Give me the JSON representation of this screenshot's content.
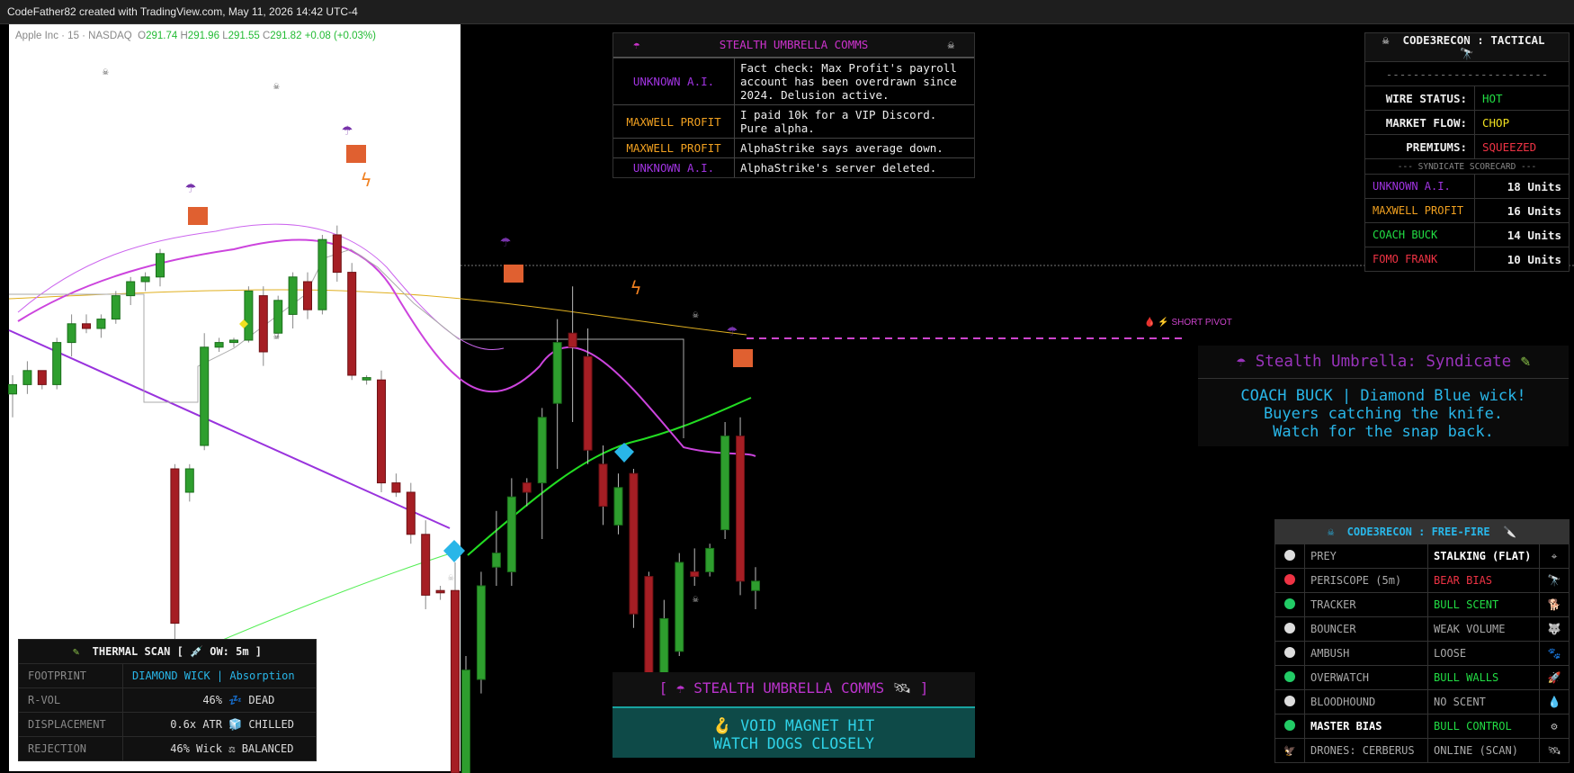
{
  "topbar": "CodeFather82 created with TradingView.com, May 11, 2026 14:42 UTC-4",
  "ohlc": {
    "symbol": "Apple Inc · 15 · NASDAQ",
    "o_label": "O",
    "o": "291.74",
    "h_label": "H",
    "h": "291.96",
    "l_label": "L",
    "l": "291.55",
    "c_label": "C",
    "c": "291.82",
    "change": "+0.08 (+0.03%)"
  },
  "pivot_label": "SHORT PIVOT",
  "comms": {
    "title": "STEALTH UMBRELLA COMMS",
    "rows": [
      {
        "who": "UNKNOWN A.I.",
        "color": "#a033e0",
        "msg": "Fact check: Max Profit's payroll account has been overdrawn since 2024. Delusion active."
      },
      {
        "who": "MAXWELL PROFIT",
        "color": "#f0a020",
        "msg": "I paid 10k for a VIP Discord. Pure alpha."
      },
      {
        "who": "MAXWELL PROFIT",
        "color": "#f0a020",
        "msg": "AlphaStrike says average down."
      },
      {
        "who": "UNKNOWN A.I.",
        "color": "#a033e0",
        "msg": "AlphaStrike's server deleted."
      }
    ]
  },
  "tactical": {
    "title": "CODE3RECON : TACTICAL",
    "dashes": "------------------------",
    "status": [
      {
        "label": "WIRE STATUS:",
        "value": "HOT",
        "color": "#22dd44"
      },
      {
        "label": "MARKET FLOW:",
        "value": "CHOP",
        "color": "#f0e020"
      },
      {
        "label": "PREMIUMS:",
        "value": "SQUEEZED",
        "color": "#ee3344"
      }
    ],
    "scorecard_title": "--- SYNDICATE SCORECARD ---",
    "scores": [
      {
        "name": "UNKNOWN A.I.",
        "units": "18 Units",
        "color": "#a033e0"
      },
      {
        "name": "MAXWELL PROFIT",
        "units": "16 Units",
        "color": "#f0a020"
      },
      {
        "name": "COACH BUCK",
        "units": "14 Units",
        "color": "#22dd44"
      },
      {
        "name": "FOMO FRANK",
        "units": "10 Units",
        "color": "#ee3344"
      }
    ]
  },
  "syndicate": {
    "title": "Stealth Umbrella: Syndicate",
    "line1": "COACH BUCK | Diamond Blue wick!",
    "line2": "Buyers catching the knife.",
    "line3": "Watch for the snap back."
  },
  "freefire": {
    "title": "CODE3RECON : FREE-FIRE",
    "rows": [
      {
        "dot": "#ddd",
        "key": "PREY",
        "value": "STALKING (FLAT)",
        "vcolor": "#ffffff",
        "bold": false,
        "vbold": true,
        "icon": "target-icon"
      },
      {
        "dot": "#ee3344",
        "key": "PERISCOPE (5m)",
        "value": "BEAR BIAS",
        "vcolor": "#ee3344",
        "bold": false,
        "vbold": false,
        "icon": "telescope-icon"
      },
      {
        "dot": "#22cc66",
        "key": "TRACKER",
        "value": "BULL SCENT",
        "vcolor": "#22dd44",
        "bold": false,
        "vbold": false,
        "icon": "dog-icon"
      },
      {
        "dot": "#ddd",
        "key": "BOUNCER",
        "value": "WEAK VOLUME",
        "vcolor": "#aaaaaa",
        "bold": false,
        "vbold": false,
        "icon": "wolf-icon"
      },
      {
        "dot": "#ddd",
        "key": "AMBUSH",
        "value": "LOOSE",
        "vcolor": "#aaaaaa",
        "bold": false,
        "vbold": false,
        "icon": "paw-icon"
      },
      {
        "dot": "#22cc66",
        "key": "OVERWATCH",
        "value": "BULL WALLS",
        "vcolor": "#22dd44",
        "bold": false,
        "vbold": false,
        "icon": "rocket-icon"
      },
      {
        "dot": "#ddd",
        "key": "BLOODHOUND",
        "value": "NO SCENT",
        "vcolor": "#aaaaaa",
        "bold": false,
        "vbold": false,
        "icon": "drop-icon"
      },
      {
        "dot": "#22cc66",
        "key": "MASTER BIAS",
        "value": "BULL CONTROL",
        "vcolor": "#22dd44",
        "bold": true,
        "vbold": false,
        "icon": "gear-icon"
      },
      {
        "dot": "drone",
        "key": "DRONES: CERBERUS",
        "value": "ONLINE (SCAN)",
        "vcolor": "#aaaaaa",
        "bold": false,
        "vbold": false,
        "icon": "satellite-icon"
      }
    ]
  },
  "thermal": {
    "title": "THERMAL SCAN [",
    "title_tail": "OW: 5m ]",
    "rows": [
      {
        "key": "FOOTPRINT",
        "value": "DIAMOND WICK | Absorption",
        "color": "#29b6e8",
        "align": "left"
      },
      {
        "key": "R-VOL",
        "value": "46%",
        "tail": "DEAD",
        "color": "#dddddd",
        "align": "right"
      },
      {
        "key": "DISPLACEMENT",
        "value": "0.6x ATR",
        "tail": "CHILLED",
        "color": "#dddddd",
        "align": "right"
      },
      {
        "key": "REJECTION",
        "value": "46% Wick",
        "tail": "BALANCED",
        "color": "#dddddd",
        "align": "right"
      }
    ]
  },
  "bcomms": {
    "title": "STEALTH UMBRELLA COMMS",
    "line1": "VOID MAGNET HIT",
    "line2": "WATCH DOGS CLOSELY"
  },
  "colors": {
    "bull": "#2e9e2e",
    "bear": "#a51e24",
    "accent": "#cc44cc"
  },
  "chart_data": {
    "type": "candlestick",
    "title": "",
    "ylim": [
      291.0,
      294.2
    ],
    "candles": [
      {
        "o": 292.62,
        "h": 292.7,
        "l": 292.52,
        "c": 292.66
      },
      {
        "o": 292.66,
        "h": 292.76,
        "l": 292.62,
        "c": 292.72
      },
      {
        "o": 292.72,
        "h": 292.68,
        "l": 292.64,
        "c": 292.66
      },
      {
        "o": 292.66,
        "h": 292.86,
        "l": 292.64,
        "c": 292.84
      },
      {
        "o": 292.84,
        "h": 292.96,
        "l": 292.78,
        "c": 292.92
      },
      {
        "o": 292.92,
        "h": 292.96,
        "l": 292.88,
        "c": 292.9
      },
      {
        "o": 292.9,
        "h": 292.96,
        "l": 292.86,
        "c": 292.94
      },
      {
        "o": 292.94,
        "h": 293.06,
        "l": 292.92,
        "c": 293.04
      },
      {
        "o": 293.04,
        "h": 293.12,
        "l": 293.0,
        "c": 293.1
      },
      {
        "o": 293.1,
        "h": 293.14,
        "l": 293.06,
        "c": 293.12
      },
      {
        "o": 293.12,
        "h": 293.24,
        "l": 293.08,
        "c": 293.22
      },
      {
        "o": 292.3,
        "h": 292.32,
        "l": 291.4,
        "c": 291.64
      },
      {
        "o": 292.2,
        "h": 292.32,
        "l": 292.16,
        "c": 292.3
      },
      {
        "o": 292.4,
        "h": 292.88,
        "l": 292.38,
        "c": 292.82
      },
      {
        "o": 292.82,
        "h": 292.86,
        "l": 292.8,
        "c": 292.84
      },
      {
        "o": 292.84,
        "h": 292.86,
        "l": 292.82,
        "c": 292.85
      },
      {
        "o": 292.85,
        "h": 293.08,
        "l": 292.84,
        "c": 293.06
      },
      {
        "o": 293.04,
        "h": 293.08,
        "l": 292.74,
        "c": 292.8
      },
      {
        "o": 292.88,
        "h": 293.04,
        "l": 292.86,
        "c": 293.02
      },
      {
        "o": 292.96,
        "h": 293.14,
        "l": 292.9,
        "c": 293.12
      },
      {
        "o": 293.1,
        "h": 293.14,
        "l": 292.94,
        "c": 292.98
      },
      {
        "o": 292.98,
        "h": 293.3,
        "l": 292.96,
        "c": 293.28
      },
      {
        "o": 293.3,
        "h": 293.34,
        "l": 293.1,
        "c": 293.14
      },
      {
        "o": 293.14,
        "h": 293.18,
        "l": 292.68,
        "c": 292.7
      },
      {
        "o": 292.68,
        "h": 292.7,
        "l": 292.66,
        "c": 292.69
      },
      {
        "o": 292.68,
        "h": 292.72,
        "l": 292.2,
        "c": 292.24
      },
      {
        "o": 292.24,
        "h": 292.28,
        "l": 292.18,
        "c": 292.2
      },
      {
        "o": 292.2,
        "h": 292.24,
        "l": 291.98,
        "c": 292.02
      },
      {
        "o": 292.02,
        "h": 292.08,
        "l": 291.7,
        "c": 291.76
      },
      {
        "o": 291.78,
        "h": 291.8,
        "l": 291.74,
        "c": 291.77
      },
      {
        "o": 291.78,
        "h": 291.9,
        "l": 290.9,
        "c": 291.0
      },
      {
        "o": 290.98,
        "h": 291.5,
        "l": 290.86,
        "c": 291.44
      },
      {
        "o": 291.4,
        "h": 291.86,
        "l": 291.34,
        "c": 291.8
      },
      {
        "o": 291.88,
        "h": 292.12,
        "l": 291.8,
        "c": 291.94
      },
      {
        "o": 291.86,
        "h": 292.26,
        "l": 291.8,
        "c": 292.18
      },
      {
        "o": 292.24,
        "h": 292.26,
        "l": 292.14,
        "c": 292.2
      },
      {
        "o": 292.24,
        "h": 292.56,
        "l": 292.0,
        "c": 292.52
      },
      {
        "o": 292.58,
        "h": 292.94,
        "l": 292.3,
        "c": 292.84
      },
      {
        "o": 292.88,
        "h": 293.08,
        "l": 292.5,
        "c": 292.82
      },
      {
        "o": 292.78,
        "h": 292.9,
        "l": 292.32,
        "c": 292.38
      },
      {
        "o": 292.32,
        "h": 292.4,
        "l": 292.06,
        "c": 292.14
      },
      {
        "o": 292.06,
        "h": 292.28,
        "l": 292.02,
        "c": 292.22
      },
      {
        "o": 292.28,
        "h": 292.3,
        "l": 291.62,
        "c": 291.68
      },
      {
        "o": 291.84,
        "h": 291.86,
        "l": 291.24,
        "c": 291.32
      },
      {
        "o": 291.34,
        "h": 291.74,
        "l": 291.22,
        "c": 291.66
      },
      {
        "o": 291.52,
        "h": 291.94,
        "l": 291.5,
        "c": 291.9
      },
      {
        "o": 291.86,
        "h": 291.96,
        "l": 291.8,
        "c": 291.84
      },
      {
        "o": 291.86,
        "h": 291.98,
        "l": 291.84,
        "c": 291.96
      },
      {
        "o": 292.04,
        "h": 292.5,
        "l": 292.0,
        "c": 292.44
      },
      {
        "o": 292.44,
        "h": 292.52,
        "l": 291.76,
        "c": 291.82
      },
      {
        "o": 291.78,
        "h": 291.88,
        "l": 291.7,
        "c": 291.82
      }
    ]
  }
}
